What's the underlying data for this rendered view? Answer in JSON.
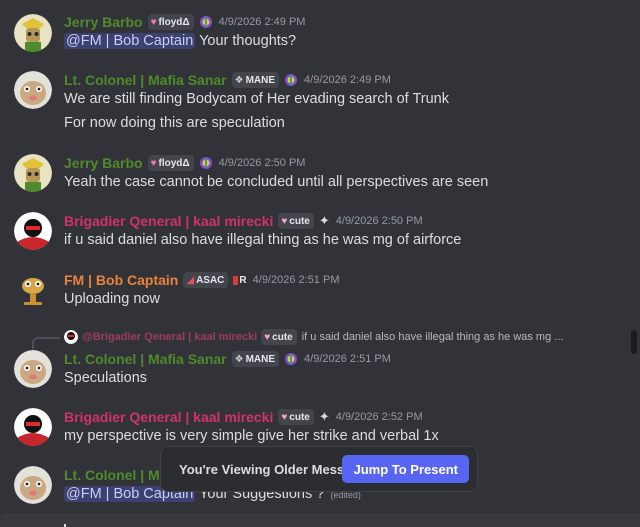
{
  "colors": {
    "background": "#323339",
    "green_name": "#4f8a2b",
    "pink_name": "#d0336b",
    "orange_name": "#e8833a",
    "mention_bg": "#4a4f8a",
    "jump_button": "#5865f2"
  },
  "messages": [
    {
      "author": "Jerry Barbo",
      "tag": {
        "icon": "heart-icon",
        "text": "floydΔ"
      },
      "time": "4/9/2026 2:49 PM",
      "lines": [
        {
          "mention": "@FM | Bob Captain",
          "text": "Your thoughts?"
        }
      ]
    },
    {
      "author": "Lt. Colonel | Mafia Sanar",
      "tag": {
        "icon": "diamond-icon",
        "text": "MANE"
      },
      "time": "4/9/2026 2:49 PM",
      "lines": [
        {
          "text": "We are still finding Bodycam of Her evading search of Trunk"
        },
        {
          "text": "For now doing this are speculation"
        }
      ]
    },
    {
      "author": "Jerry Barbo",
      "tag": {
        "icon": "heart-icon",
        "text": "floydΔ"
      },
      "time": "4/9/2026 2:50 PM",
      "lines": [
        {
          "text": "Yeah the case cannot be concluded until all perspectives are seen"
        }
      ]
    },
    {
      "author": "Brigadier Qeneral | kaal mirecki",
      "tag": {
        "icon": "heart-icon",
        "text": "cute"
      },
      "time": "4/9/2026 2:50 PM",
      "lines": [
        {
          "text": "if u said daniel also have illegal thing as he was mg of airforce"
        }
      ]
    },
    {
      "author": "FM | Bob Captain",
      "tag": {
        "icon": "ticket-icon",
        "text": "ASAC"
      },
      "extra_tag": "R",
      "time": "4/9/2026 2:51 PM",
      "lines": [
        {
          "text": "Uploading now"
        }
      ]
    },
    {
      "reply": {
        "author": "@Brigadier Qeneral | kaal mirecki",
        "tag": "cute",
        "text": "if u said daniel also have illegal thing as he was mg ..."
      },
      "author": "Lt. Colonel | Mafia Sanar",
      "tag": {
        "icon": "diamond-icon",
        "text": "MANE"
      },
      "time": "4/9/2026 2:51 PM",
      "lines": [
        {
          "text": "Speculations"
        }
      ]
    },
    {
      "author": "Brigadier Qeneral | kaal mirecki",
      "tag": {
        "icon": "heart-icon",
        "text": "cute"
      },
      "time": "4/9/2026 2:52 PM",
      "lines": [
        {
          "text": "my perspective is very simple give her strike and verbal 1x"
        }
      ]
    },
    {
      "author": "Lt. Colonel | Ma",
      "lines": [
        {
          "mention": "@FM | Bob Captain",
          "text": "Your Suggestions ?",
          "edited": "(edited)"
        }
      ]
    }
  ],
  "older_messages_bar": {
    "text": "You're Viewing Older Messages",
    "button": "Jump To Present"
  }
}
